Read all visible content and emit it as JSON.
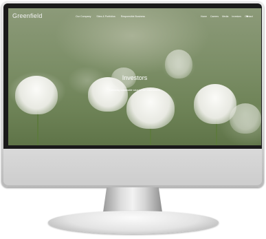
{
  "site": {
    "logo": "Greenfield",
    "nav_left": [
      "Our Company",
      "Sites & Portfolios",
      "Responsible Business"
    ],
    "nav_right": [
      "Home",
      "Careers",
      "Media",
      "Investors",
      "Contact"
    ],
    "language_icon": "globe-icon"
  },
  "hero": {
    "title": "Investors",
    "subtitle": "Delivering sustainable value for our shareholders"
  }
}
